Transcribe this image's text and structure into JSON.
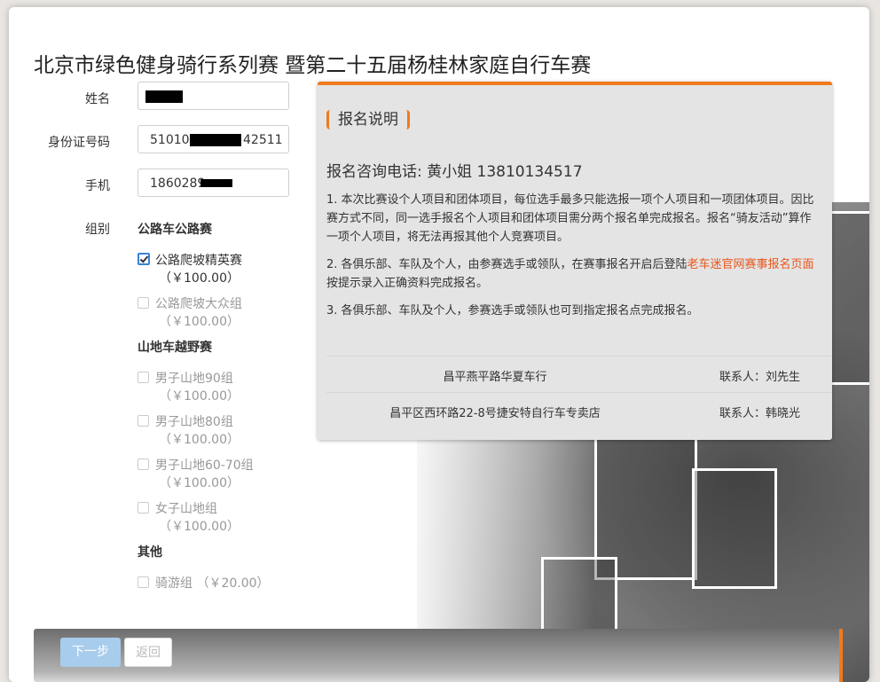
{
  "title": "北京市绿色健身骑行系列赛 暨第二十五届杨桂林家庭自行车赛",
  "form": {
    "name_label": "姓名",
    "id_label": "身份证号码",
    "id_prefix": "510105",
    "id_suffix": "42511",
    "phone_label": "手机",
    "phone_prefix": "1860289",
    "group_label": "组别"
  },
  "groups": {
    "road": {
      "heading": "公路车公路赛",
      "items": [
        {
          "label": "公路爬坡精英赛",
          "price": "（￥100.00）",
          "checked": true
        },
        {
          "label": "公路爬坡大众组",
          "price": "（￥100.00）",
          "checked": false
        }
      ]
    },
    "mtb": {
      "heading": "山地车越野赛",
      "items": [
        {
          "label": "男子山地90组",
          "price": "（￥100.00）"
        },
        {
          "label": "男子山地80组",
          "price": "（￥100.00）"
        },
        {
          "label": "男子山地60-70组",
          "price": "（￥100.00）"
        },
        {
          "label": "女子山地组",
          "price": "（￥100.00）"
        }
      ]
    },
    "other": {
      "heading": "其他",
      "items": [
        {
          "label": "骑游组 （￥20.00）"
        }
      ]
    }
  },
  "notice": {
    "tag": "报名说明",
    "phone": "报名咨询电话: 黄小姐 13810134517",
    "p1": "1. 本次比赛设个人项目和团体项目，每位选手最多只能选报一项个人项目和一项团体项目。因比赛方式不同，同一选手报名个人项目和团体项目需分两个报名单完成报名。报名“骑友活动”算作一项个人项目，将无法再报其他个人竞赛项目。",
    "p2_before": "2. 各俱乐部、车队及个人，由参赛选手或领队，在赛事报名开启后登陆",
    "p2_link": "老车迷官网赛事报名页面",
    "p2_after": "按提示录入正确资料完成报名。",
    "p3": "3. 各俱乐部、车队及个人，参赛选手或领队也可到指定报名点完成报名。",
    "locations": [
      {
        "name": "昌平燕平路华夏车行",
        "contact": "联系人：刘先生"
      },
      {
        "name": "昌平区西环路22-8号捷安特自行车专卖店",
        "contact": "联系人：韩晓光"
      }
    ]
  },
  "buttons": {
    "next": "下一步",
    "back": "返回"
  },
  "colors": {
    "accent": "#f07a1d",
    "link": "#e8561b",
    "primary_button": "#a8ccec"
  }
}
